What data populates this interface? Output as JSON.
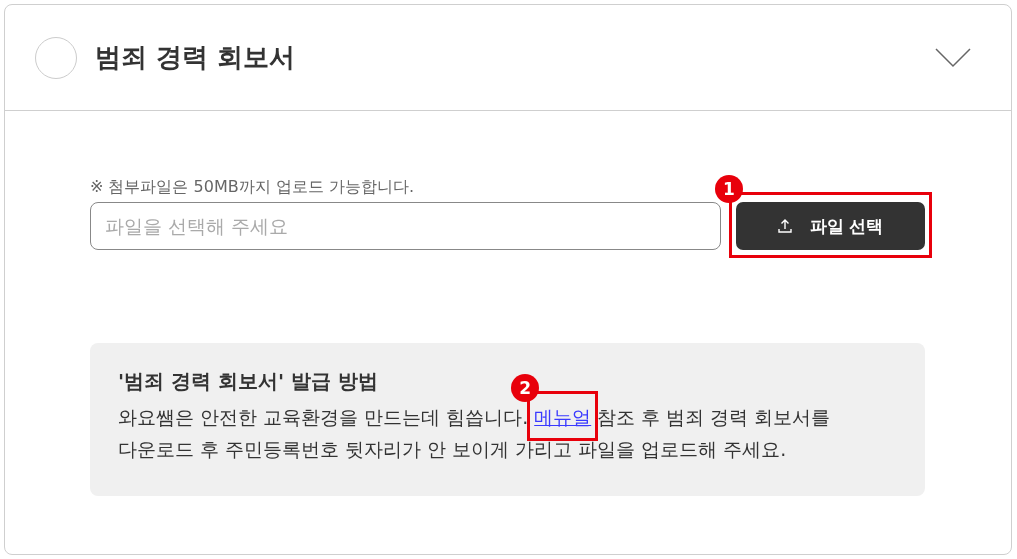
{
  "header": {
    "title": "범죄 경력 회보서",
    "completed": false,
    "expanded": false
  },
  "upload": {
    "note": "※ 첨부파일은 50MB까지 업로드 가능합니다.",
    "placeholder": "파일을 선택해 주세요",
    "button": "파일 선택",
    "callout": "1"
  },
  "guide": {
    "title": "'범죄 경력 회보서' 발급 방법",
    "text_before": "와요쌤은 안전한 교육환경을 만드는데 힘씁니다.",
    "link": "메뉴얼",
    "text_after": "참조 후 범죄 경력 회보서를",
    "line_2": "다운로드 후 주민등록번호 뒷자리가 안 보이게 가리고 파일을 업로드해 주세요.",
    "callout": "2"
  }
}
